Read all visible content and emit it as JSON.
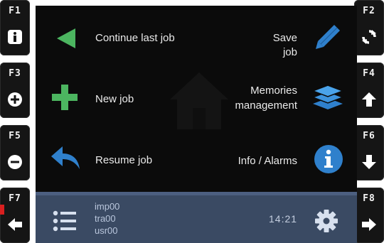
{
  "function_keys": {
    "f1": {
      "label": "F1",
      "icon": "info-icon"
    },
    "f2": {
      "label": "F2",
      "icon": "refresh-icon"
    },
    "f3": {
      "label": "F3",
      "icon": "plus-circle-icon"
    },
    "f4": {
      "label": "F4",
      "icon": "arrow-up-icon"
    },
    "f5": {
      "label": "F5",
      "icon": "minus-circle-icon"
    },
    "f6": {
      "label": "F6",
      "icon": "arrow-down-icon"
    },
    "f7": {
      "label": "F7",
      "icon": "arrow-left-icon"
    },
    "f8": {
      "label": "F8",
      "icon": "arrow-right-icon"
    }
  },
  "menu": {
    "continue_last_job": "Continue last job",
    "save_job": "Save job",
    "new_job": "New job",
    "memories_line1": "Memories",
    "memories_line2": "management",
    "resume_job": "Resume job",
    "info_alarms": "Info / Alarms"
  },
  "status_bar": {
    "lines": [
      "imp00",
      "tra00",
      "usr00"
    ],
    "time": "14:21"
  },
  "colors": {
    "green_accent": "#4cb560",
    "blue_accent": "#2f80cc",
    "bar_bg": "#3a4a63"
  }
}
